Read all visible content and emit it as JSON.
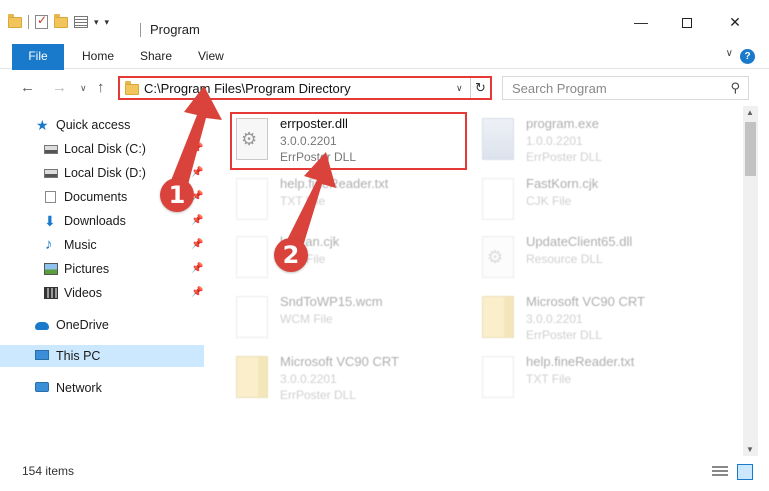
{
  "window": {
    "title": "Program",
    "min_glyph": "—",
    "close_glyph": "✕"
  },
  "ribbon": {
    "tabs": [
      "File",
      "Home",
      "Share",
      "View"
    ],
    "help_glyph": "?",
    "expand_glyph": "∨"
  },
  "navigation": {
    "back_glyph": "←",
    "forward_glyph": "→",
    "recent_glyph": "∨",
    "up_glyph": "↑",
    "address": "C:\\Program Files\\Program Directory",
    "address_drop_glyph": "∨",
    "refresh_glyph": "↻",
    "search_placeholder": "Search Program",
    "search_glyph": "⚲"
  },
  "sidebar": {
    "items": [
      {
        "label": "Quick access",
        "icon": "star-icon",
        "pinned": false
      },
      {
        "label": "Local Disk (C:)",
        "icon": "disk-icon",
        "pinned": true
      },
      {
        "label": "Local Disk (D:)",
        "icon": "disk-icon",
        "pinned": true
      },
      {
        "label": "Documents",
        "icon": "documents-icon",
        "pinned": true
      },
      {
        "label": "Downloads",
        "icon": "downloads-icon",
        "pinned": true
      },
      {
        "label": "Music",
        "icon": "music-icon",
        "pinned": true
      },
      {
        "label": "Pictures",
        "icon": "pictures-icon",
        "pinned": true
      },
      {
        "label": "Videos",
        "icon": "videos-icon",
        "pinned": true
      },
      {
        "label": "OneDrive",
        "icon": "onedrive-icon",
        "pinned": false
      },
      {
        "label": "This PC",
        "icon": "this-pc-icon",
        "pinned": false,
        "selected": true
      },
      {
        "label": "Network",
        "icon": "network-icon",
        "pinned": false
      }
    ],
    "pin_glyph": "📌"
  },
  "files": [
    {
      "name": "errposter.dll",
      "line1": "3.0.0.2201",
      "line2": "ErrPoster DLL",
      "icon": "dll-file-icon",
      "highlighted": true
    },
    {
      "name": "program.exe",
      "line1": "1.0.0.2201",
      "line2": "ErrPoster DLL",
      "icon": "exe-file-icon"
    },
    {
      "name": "help.fineReader.txt",
      "line1": "TXT File",
      "line2": "",
      "icon": "txt-file-icon"
    },
    {
      "name": "FastKorn.cjk",
      "line1": "CJK File",
      "line2": "",
      "icon": "cjk-file-icon"
    },
    {
      "name": "korean.cjk",
      "line1": "CJK File",
      "line2": "",
      "icon": "cjk-file-icon"
    },
    {
      "name": "UpdateClient65.dll",
      "line1": "Resource DLL",
      "line2": "",
      "icon": "dll-file-icon"
    },
    {
      "name": "SndToWP15.wcm",
      "line1": "WCM File",
      "line2": "",
      "icon": "wcm-file-icon"
    },
    {
      "name": "Microsoft VC90 CRT",
      "line1": "3.0.0.2201",
      "line2": "ErrPoster DLL",
      "icon": "folder-file-icon"
    },
    {
      "name": "Microsoft VC90 CRT",
      "line1": "3.0.0.2201",
      "line2": "ErrPoster DLL",
      "icon": "folder-file-icon"
    },
    {
      "name": "help.fineReader.txt",
      "line1": "TXT File",
      "line2": "",
      "icon": "txt-file-icon"
    }
  ],
  "annotations": {
    "marker_1": "1",
    "marker_2": "2",
    "color": "#d9433b"
  },
  "status": {
    "item_count": "154 items"
  },
  "scroll": {
    "up_glyph": "▲",
    "down_glyph": "▼"
  }
}
